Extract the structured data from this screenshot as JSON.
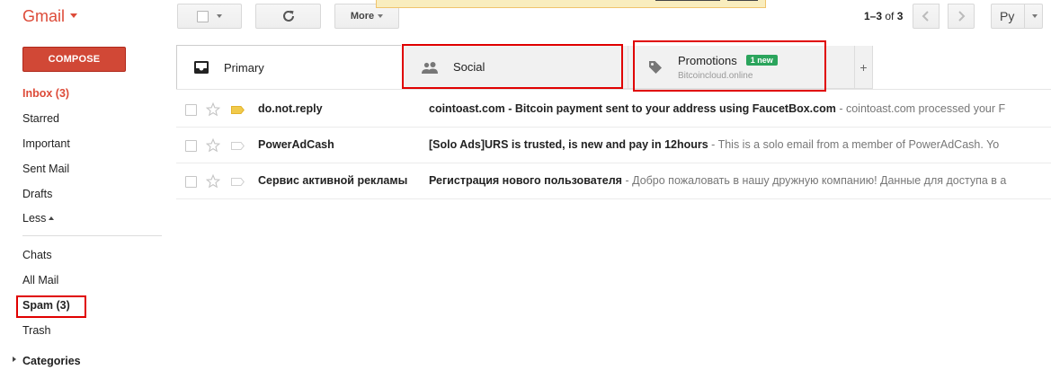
{
  "app": {
    "logo_text": "Gmail"
  },
  "toolbar": {
    "more_label": "More",
    "pager": {
      "range": "1–3",
      "of": "of",
      "total": "3"
    },
    "language_label": "Ру"
  },
  "sidebar": {
    "compose_label": "COMPOSE",
    "items": [
      {
        "label": "Inbox (3)"
      },
      {
        "label": "Starred"
      },
      {
        "label": "Important"
      },
      {
        "label": "Sent Mail"
      },
      {
        "label": "Drafts"
      },
      {
        "label": "Less"
      },
      {
        "label": "Chats"
      },
      {
        "label": "All Mail"
      },
      {
        "label": "Spam (3)"
      },
      {
        "label": "Trash"
      },
      {
        "label": "Categories"
      }
    ]
  },
  "tabs": {
    "primary": {
      "label": "Primary"
    },
    "social": {
      "label": "Social"
    },
    "promotions": {
      "label": "Promotions",
      "badge": "1 new",
      "sub": "Bitcoincloud.online"
    },
    "add": "+"
  },
  "messages": [
    {
      "sender": "do.not.reply",
      "subject": "cointoast.com - Bitcoin payment sent to your address using FaucetBox.com",
      "snippet": " - cointoast.com processed your F",
      "important_color": "#f1ca4b"
    },
    {
      "sender": "PowerAdCash",
      "subject": "[Solo Ads]URS is trusted, is new and pay in 12hours",
      "snippet": " - This is a solo email from a member of PowerAdCash. Yo",
      "important_color": "none"
    },
    {
      "sender": "Сервис активной рекламы",
      "subject": "Регистрация нового пользователя",
      "snippet": " - Добро пожаловать в нашу дружную компанию! Данные для доступа в а",
      "important_color": "none"
    }
  ],
  "colors": {
    "brand_red": "#dd4b39",
    "compose_bg": "#d14836",
    "badge_green": "#2ba45c",
    "highlight_red": "#e00000"
  }
}
